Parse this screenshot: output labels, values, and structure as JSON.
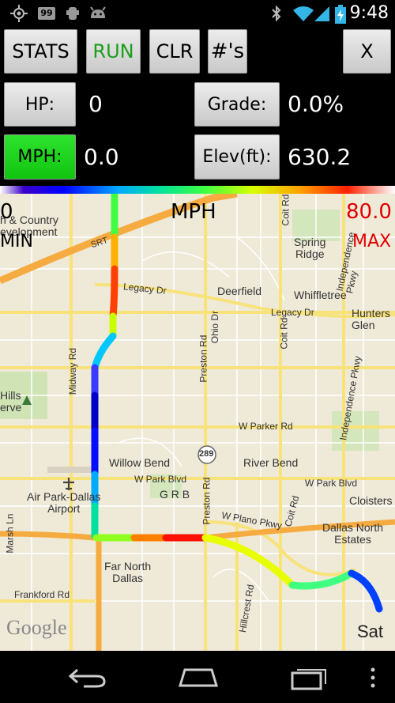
{
  "status_bar": {
    "time": "9:48",
    "notification_badge": "99",
    "icons": [
      "gps-icon",
      "notification-99-icon",
      "usb-debug-icon",
      "android-icon",
      "bluetooth-icon",
      "wifi-icon",
      "signal-icon",
      "battery-charging-icon"
    ]
  },
  "controls": {
    "stats_label": "STATS",
    "run_label": "RUN",
    "clr_label": "CLR",
    "counts_label": "#'s",
    "close_label": "X",
    "hp_label": "HP:",
    "hp_value": "0",
    "grade_label": "Grade:",
    "grade_value": "0.0%",
    "mph_label": "MPH:",
    "mph_value": "0.0",
    "elev_label": "Elev(ft):",
    "elev_value": "630.2"
  },
  "map": {
    "min_value": "0",
    "min_label": "MIN",
    "unit_label": "MPH",
    "max_value": "80.0",
    "max_label": "MAX",
    "attribution": "Google",
    "labels": {
      "country_dev": "h & Country\nevelopment",
      "srt": "SRT",
      "coit_top": "Coit Rd",
      "indep_top": "Independence Pkwy",
      "spring_ridge": "Spring\nRidge",
      "legacy_dr_w": "Legacy Dr",
      "deerfield": "Deerfield",
      "whiffletree": "Whiffletree",
      "legacy_dr_e": "Legacy Dr",
      "hunters_glen": "Hunters\nGlen",
      "ohio_dr": "Ohio Dr",
      "preston_rd_n": "Preston Rd",
      "coit_mid": "Coit Rd",
      "midway_rd": "Midway Rd",
      "hills_erve": "Hills\nerve",
      "independence_mid": "Independence Pkwy",
      "w_parker_rd": "W Parker Rd",
      "route_289": "289",
      "willow_bend": "Willow Bend",
      "river_bend": "River Bend",
      "w_park_blvd_w": "W Park Blvd",
      "w_park_blvd_e": "W Park Blvd",
      "grb": "G R B",
      "preston_rd_s": "Preston Rd",
      "coit_s": "Coit Rd",
      "cloisters": "Cloisters",
      "air_park": "Air Park-Dallas\nAirport",
      "w_plano_pkwy": "W Plano Pkwy",
      "dallas_north_estates": "Dallas North\nEstates",
      "marsh_ln": "Marsh Ln",
      "far_north_dallas": "Far North\nDallas",
      "frankford_rd": "Frankford Rd",
      "hillcrest_rd": "Hillcrest Rd",
      "sat": "Sat"
    }
  },
  "nav_bar": {
    "icons": [
      "back-icon",
      "home-icon",
      "recent-apps-icon",
      "overflow-menu-icon"
    ]
  }
}
